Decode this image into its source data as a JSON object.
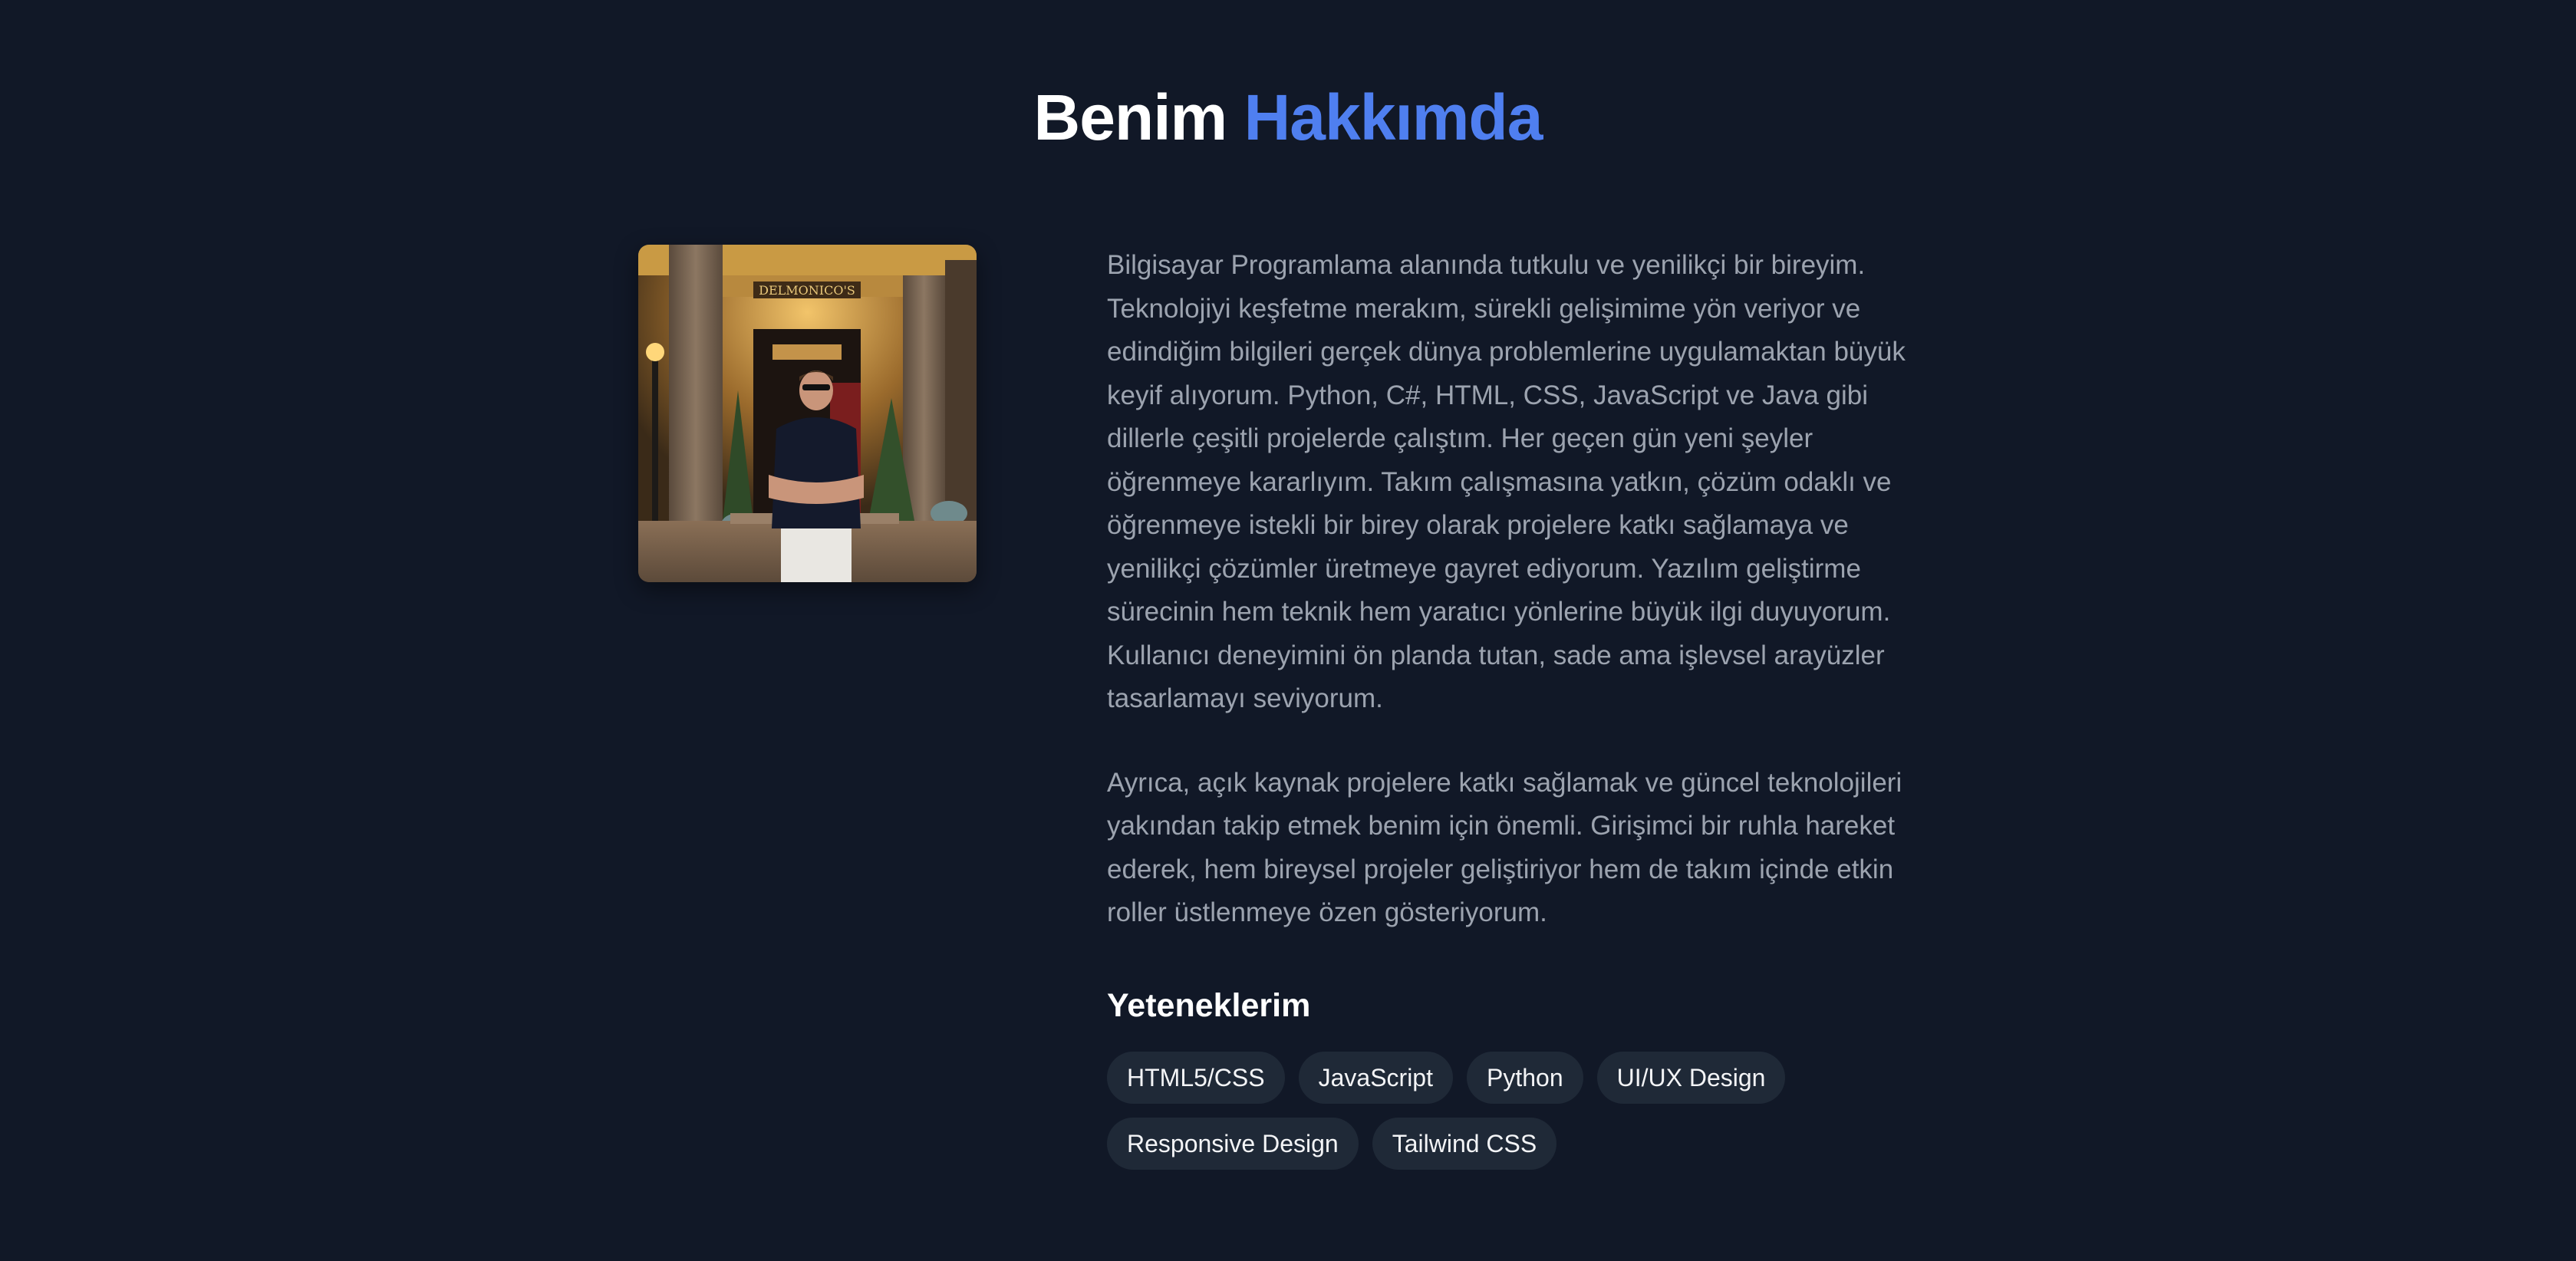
{
  "section": {
    "title_part1": "Benim",
    "title_part2": "Hakkımda"
  },
  "photo": {
    "alt": "Profil fotoğrafı",
    "sign_text": "DELMONICO'S"
  },
  "about": {
    "paragraphs": [
      "Bilgisayar Programlama alanında tutkulu ve yenilikçi bir bireyim. Teknolojiyi keşfetme merakım, sürekli gelişimime yön veriyor ve edindiğim bilgileri gerçek dünya problemlerine uygulamaktan büyük keyif alıyorum. Python, C#, HTML, CSS, JavaScript ve Java gibi dillerle çeşitli projelerde çalıştım. Her geçen gün yeni şeyler öğrenmeye kararlıyım. Takım çalışmasına yatkın, çözüm odaklı ve öğrenmeye istekli bir birey olarak projelere katkı sağlamaya ve yenilikçi çözümler üretmeye gayret ediyorum. Yazılım geliştirme sürecinin hem teknik hem yaratıcı yönlerine büyük ilgi duyuyorum. Kullanıcı deneyimini ön planda tutan, sade ama işlevsel arayüzler tasarlamayı seviyorum.",
      "Ayrıca, açık kaynak projelere katkı sağlamak ve güncel teknolojileri yakından takip etmek benim için önemli. Girişimci bir ruhla hareket ederek, hem bireysel projeler geliştiriyor hem de takım içinde etkin roller üstlenmeye özen gösteriyorum."
    ]
  },
  "skills": {
    "title": "Yeteneklerim",
    "items": [
      "HTML5/CSS",
      "JavaScript",
      "Python",
      "UI/UX Design",
      "Responsive Design",
      "Tailwind CSS"
    ]
  },
  "colors": {
    "background": "#111827",
    "accent": "#4f7ff0",
    "text_muted": "#9ca3af",
    "tag_bg": "#1f2937"
  }
}
